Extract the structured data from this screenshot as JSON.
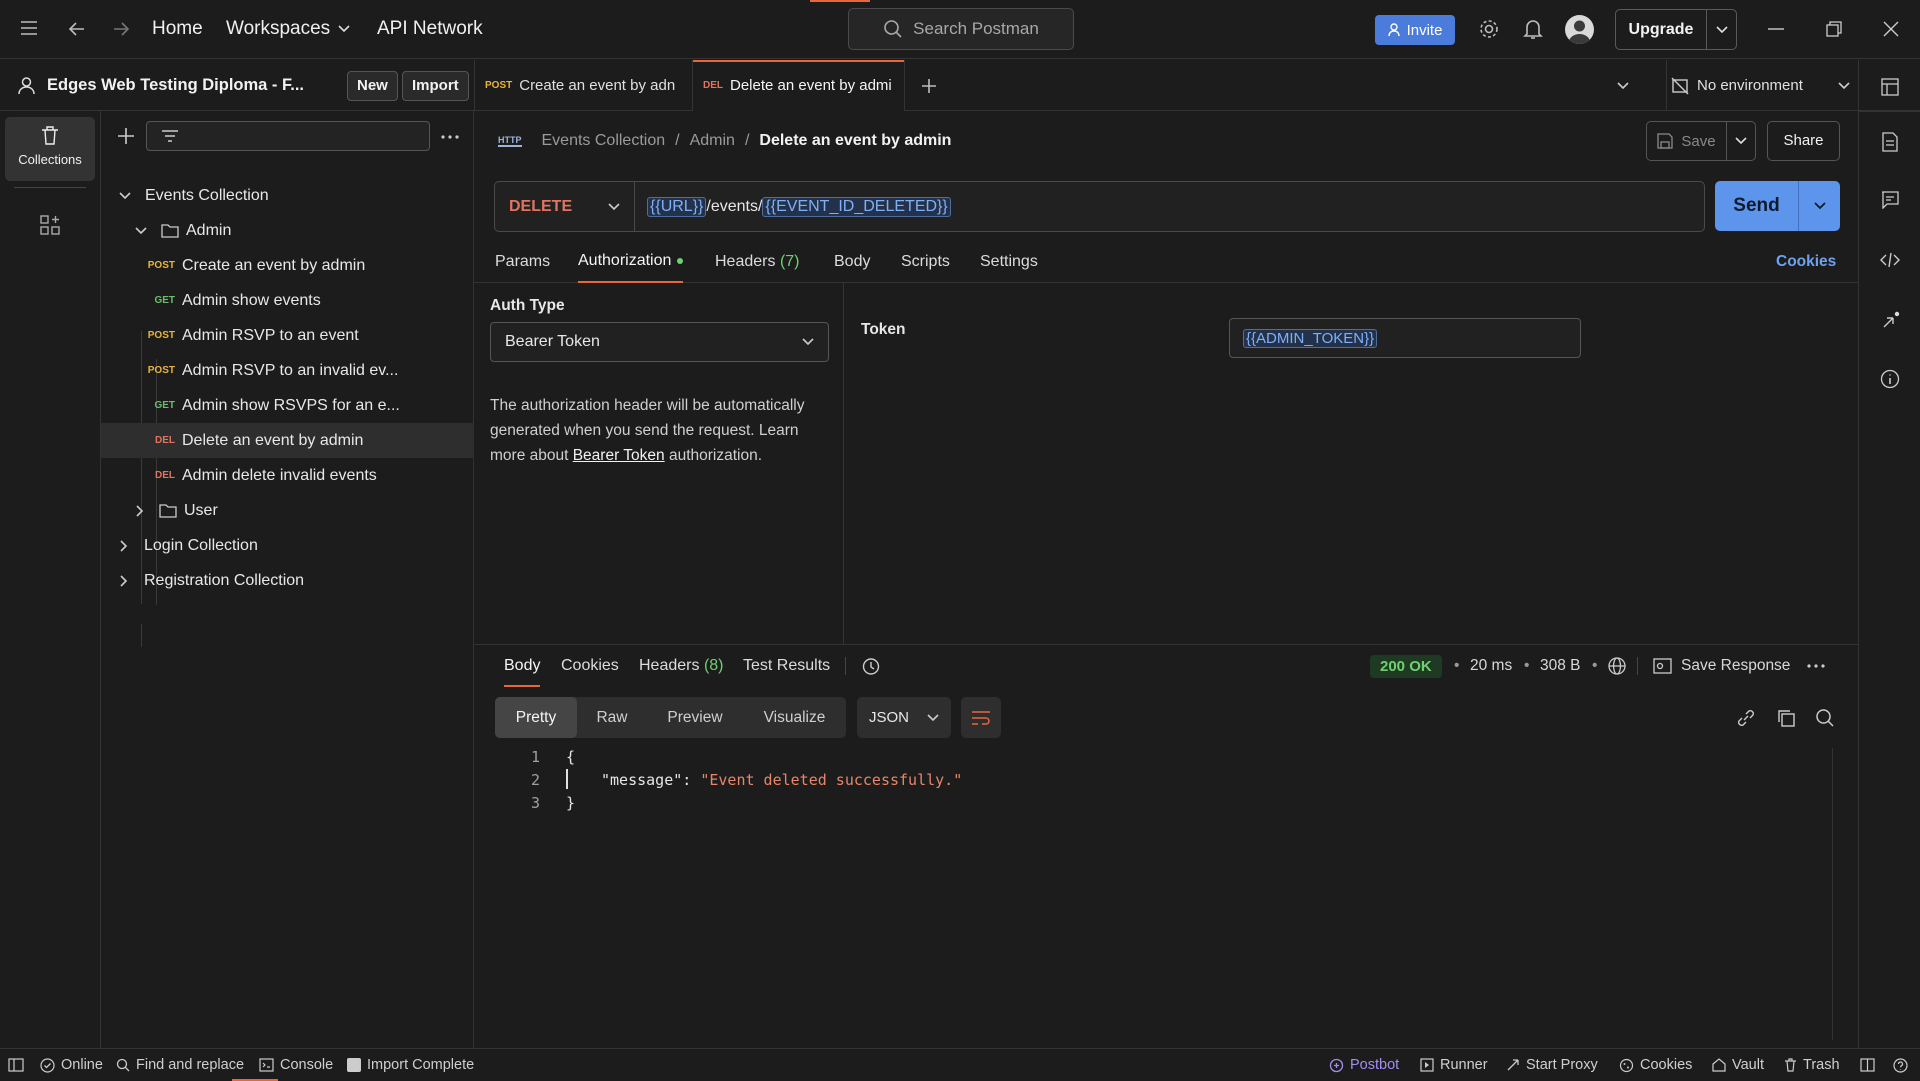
{
  "topbar": {
    "home": "Home",
    "workspaces": "Workspaces",
    "api_network": "API Network",
    "search_placeholder": "Search Postman",
    "invite": "Invite",
    "upgrade": "Upgrade"
  },
  "workspace": {
    "title": "Edges Web Testing Diploma - F...",
    "new_label": "New",
    "import_label": "Import"
  },
  "tabs": [
    {
      "method": "POST",
      "label": "Create an event by adn"
    },
    {
      "method": "DEL",
      "label": "Delete an event by admi"
    }
  ],
  "environment": "No environment",
  "rail": {
    "collections": "Collections"
  },
  "tree": {
    "events_collection": "Events Collection",
    "admin_folder": "Admin",
    "requests": [
      {
        "method": "POST",
        "label": "Create an event by admin"
      },
      {
        "method": "GET",
        "label": "Admin show events"
      },
      {
        "method": "POST",
        "label": "Admin RSVP to an event"
      },
      {
        "method": "POST",
        "label": "Admin RSVP to an invalid ev..."
      },
      {
        "method": "GET",
        "label": "Admin show RSVPS for an e..."
      },
      {
        "method": "DEL",
        "label": "Delete an event by admin"
      },
      {
        "method": "DEL",
        "label": "Admin delete invalid events"
      }
    ],
    "user_folder": "User",
    "login_collection": "Login Collection",
    "registration_collection": "Registration Collection"
  },
  "breadcrumb": {
    "icon_text": "HTTP",
    "collection": "Events Collection",
    "separator": "/",
    "folder": "Admin",
    "current": "Delete an event by admin"
  },
  "actions": {
    "save": "Save",
    "share": "Share",
    "send": "Send"
  },
  "request": {
    "method": "DELETE",
    "url_var1": "{{URL}}",
    "url_path": "/events/",
    "url_var2": "{{EVENT_ID_DELETED}}"
  },
  "request_tabs": {
    "params": "Params",
    "authorization": "Authorization",
    "headers": "Headers",
    "headers_count": "(7)",
    "body": "Body",
    "scripts": "Scripts",
    "settings": "Settings",
    "cookies": "Cookies"
  },
  "auth": {
    "type_label": "Auth Type",
    "type_value": "Bearer Token",
    "desc_pre": "The authorization header will be automatically generated when you send the request. Learn more about ",
    "desc_link": "Bearer Token",
    "desc_post": " authorization.",
    "token_label": "Token",
    "token_value": "{{ADMIN_TOKEN}}"
  },
  "response": {
    "tabs": {
      "body": "Body",
      "cookies": "Cookies",
      "headers": "Headers",
      "headers_count": "(8)",
      "test_results": "Test Results"
    },
    "status": "200 OK",
    "time": "20 ms",
    "size": "308 B",
    "save_response": "Save Response",
    "views": [
      "Pretty",
      "Raw",
      "Preview",
      "Visualize"
    ],
    "format": "JSON",
    "lines": [
      {
        "num": "1",
        "text": "{"
      },
      {
        "num": "2",
        "key": "\"message\"",
        "colon": ": ",
        "value": "\"Event deleted successfully.\""
      },
      {
        "num": "3",
        "text": "}"
      }
    ]
  },
  "statusbar": {
    "online": "Online",
    "find_replace": "Find and replace",
    "console": "Console",
    "import_complete": "Import Complete",
    "postbot": "Postbot",
    "runner": "Runner",
    "start_proxy": "Start Proxy",
    "cookies": "Cookies",
    "vault": "Vault",
    "trash": "Trash"
  },
  "colors": {
    "accent": "#e8663a",
    "send": "#5e95ec",
    "method_post": "#e8b43c",
    "method_get": "#6bbd6d",
    "method_del": "#e0745e",
    "status_ok": "#6fd16f"
  }
}
